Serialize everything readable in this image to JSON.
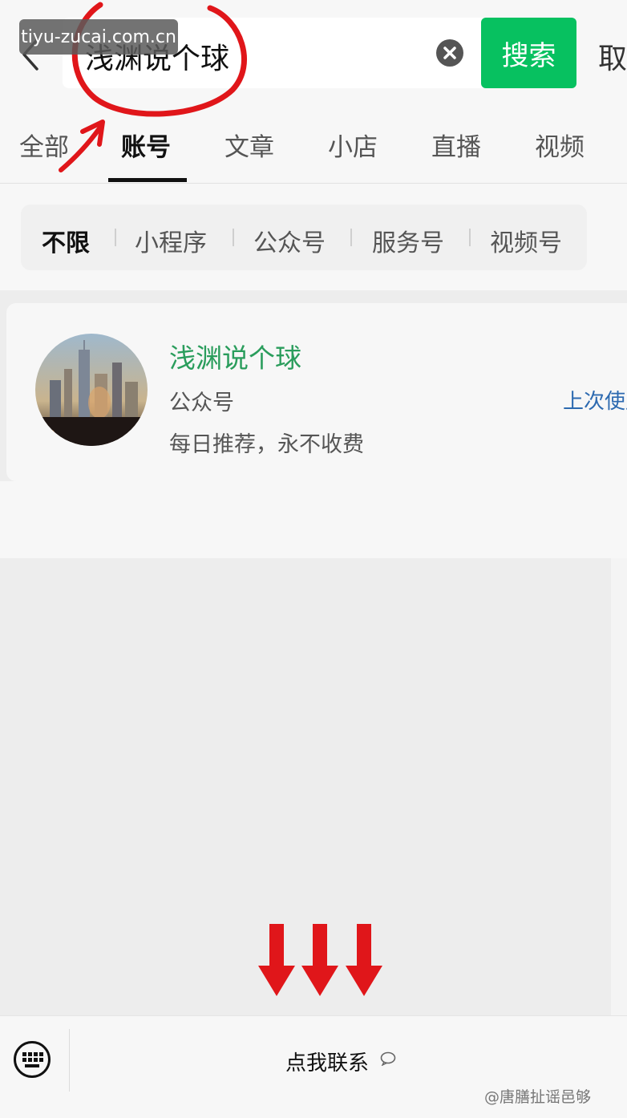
{
  "colors": {
    "accent_green": "#07c160",
    "account_name": "#2a9d5c",
    "link_blue": "#2d6ab0",
    "annotation_red": "#e0161a"
  },
  "watermark": {
    "text": "tiyu-zucai.com.cn"
  },
  "header": {
    "back_icon": "chevron-left-icon",
    "search_value": "浅渊说个球",
    "clear_icon": "clear-circle-icon",
    "search_button": "搜索",
    "cancel_label": "取"
  },
  "tabs": {
    "items": [
      "全部",
      "账号",
      "文章",
      "小店",
      "直播",
      "视频"
    ],
    "active": "账号"
  },
  "filters": {
    "items": [
      "不限",
      "小程序",
      "公众号",
      "服务号",
      "视频号"
    ],
    "active": "不限"
  },
  "result": {
    "name": "浅渊说个球",
    "type": "公众号",
    "description": "每日推荐，永不收费",
    "last_used": "上次使用"
  },
  "bottom_bar": {
    "keyboard_icon": "keyboard-icon",
    "contact_label": "点我联系",
    "bubble_icon": "chat-bubble-icon",
    "credit": "@唐膳扯谣邑够"
  }
}
